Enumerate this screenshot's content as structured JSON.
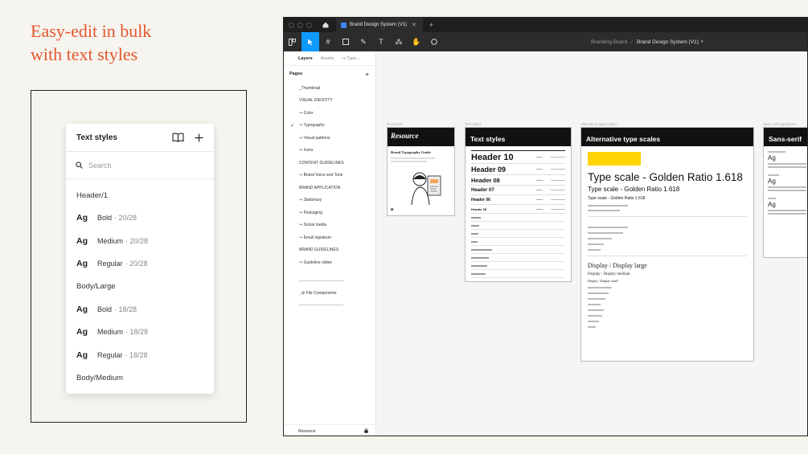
{
  "hero": {
    "line1": "Easy-edit in bulk",
    "line2": "with text styles"
  },
  "text_styles_panel": {
    "title": "Text styles",
    "search_placeholder": "Search",
    "groups": [
      {
        "name": "Header/1",
        "items": [
          {
            "ag": "Ag",
            "weight": "Bold",
            "meta": "· 20/28"
          },
          {
            "ag": "Ag",
            "weight": "Medium",
            "meta": "· 20/28"
          },
          {
            "ag": "Ag",
            "weight": "Regular",
            "meta": "· 20/28"
          }
        ]
      },
      {
        "name": "Body/Large",
        "items": [
          {
            "ag": "Ag",
            "weight": "Bold",
            "meta": "· 18/28"
          },
          {
            "ag": "Ag",
            "weight": "Medium",
            "meta": "· 18/28"
          },
          {
            "ag": "Ag",
            "weight": "Regular",
            "meta": "· 18/28"
          }
        ]
      },
      {
        "name": "Body/Medium",
        "items": []
      }
    ]
  },
  "figma": {
    "tab_label": "Brand Design System (V1)",
    "breadcrumb": {
      "project": "Branding Board",
      "separator": "/",
      "file": "Brand Design System (V1)"
    },
    "sidebar": {
      "tabs": [
        "Layers",
        "Assets",
        "↪ Typo..."
      ],
      "pages_label": "Pages",
      "pages": [
        "_Thumbnail",
        "VISUAL IDENTITY",
        "↪ Color",
        "↪ Typography",
        "↪ Visual patterns",
        "↪ Icons",
        "CONTENT GUIDELINES",
        "↪ Brand Voice and Tone",
        "BRAND APPLICATION",
        "↪ Stationary",
        "↪ Packaging",
        "↪ Social media",
        "↪ Email signature",
        "BRAND GUIDELINES",
        "↪ Guideline slides"
      ],
      "selected_page": "↪ Typography",
      "extra_pages": [
        "_⚙ File Components"
      ],
      "footer_label": "Resource"
    },
    "frames": {
      "resource": {
        "label": "Resource",
        "title": "Resource",
        "subtitle": "Brand Typography Guide"
      },
      "text_styles": {
        "label": "Text styles",
        "title": "Text styles",
        "rows": [
          "Header 10",
          "Header 09",
          "Header 08",
          "Header 07",
          "Header 06",
          "Header 05"
        ]
      },
      "alt_scales": {
        "label": "Alternative type scales",
        "title": "Alternative type scales",
        "big": "Type scale - Golden Ratio 1.618",
        "mid": "Type scale - Golden Ratio 1.618",
        "small": "Type scale - Golden Ratio 1.618",
        "display_title": "Display / Display large",
        "display_mid": "Display / Display medium",
        "display_small": "Display / Display small"
      },
      "sans_serif": {
        "label": "Sans-serif typefaces",
        "title": "Sans-serif",
        "ag": "Ag"
      }
    }
  }
}
